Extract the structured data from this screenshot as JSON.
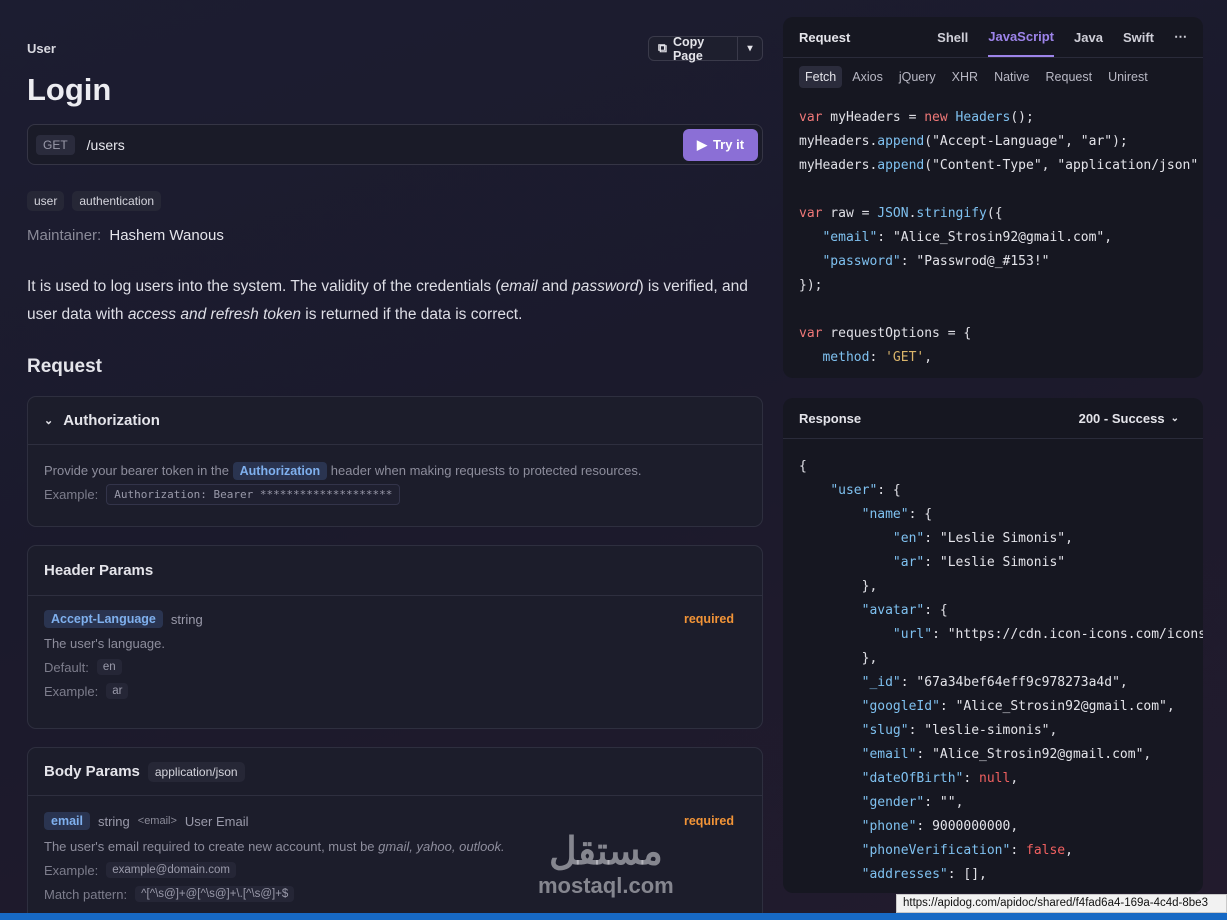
{
  "doc": {
    "breadcrumb": "User",
    "title": "Login",
    "copy_page": "Copy Page",
    "method": "GET",
    "path": "/users",
    "try_it": "Try it",
    "tags": [
      "user",
      "authentication"
    ],
    "maintainer_label": "Maintainer:",
    "maintainer_name": "Hashem Wanous",
    "description": {
      "p1": "It is used to log users into the system. The validity of the credentials (",
      "em1": "email",
      "p2": " and ",
      "em2": "password",
      "p3": ") is verified, and user data with ",
      "em3": "access and refresh token",
      "p4": " is returned if the data is correct."
    },
    "request_title": "Request"
  },
  "authorization": {
    "title": "Authorization",
    "text_before": "Provide your bearer token in the",
    "header_name": "Authorization",
    "text_after": "header when making requests to protected resources.",
    "example_label": "Example:",
    "example_value": "Authorization: Bearer ********************"
  },
  "header_params": {
    "title": "Header Params",
    "name": "Accept-Language",
    "type": "string",
    "required": "required",
    "desc": "The user's language.",
    "default_label": "Default:",
    "default_value": "en",
    "example_label": "Example:",
    "example_value": "ar"
  },
  "body_params": {
    "title": "Body Params",
    "content_type": "application/json",
    "name": "email",
    "type": "string",
    "format": "<email>",
    "label": "User Email",
    "required": "required",
    "desc_pre": "The user's email required to create new account, must be",
    "desc_em": "gmail, yahoo, outlook.",
    "example_label": "Example:",
    "example_value": "example@domain.com",
    "pattern_label": "Match pattern:",
    "pattern_value": "^[^\\s@]+@[^\\s@]+\\.[^\\s@]+$"
  },
  "request_panel": {
    "title": "Request",
    "lang_tabs": [
      "Shell",
      "JavaScript",
      "Java",
      "Swift",
      "⋯"
    ],
    "active_lang": "JavaScript",
    "sub_tabs": [
      "Fetch",
      "Axios",
      "jQuery",
      "XHR",
      "Native",
      "Request",
      "Unirest"
    ],
    "active_sub": "Fetch"
  },
  "response_panel": {
    "title": "Response",
    "status": "200 - Success"
  },
  "overlay": {
    "url": "https://apidog.com/apidoc/shared/f4fad6a4-169a-4c4d-8be3",
    "watermark_ar": "مستقل",
    "watermark_en": "mostaql.com"
  },
  "colors": {
    "accent": "#8b6fd6",
    "required": "#f29437",
    "background": "#1c1d31"
  }
}
